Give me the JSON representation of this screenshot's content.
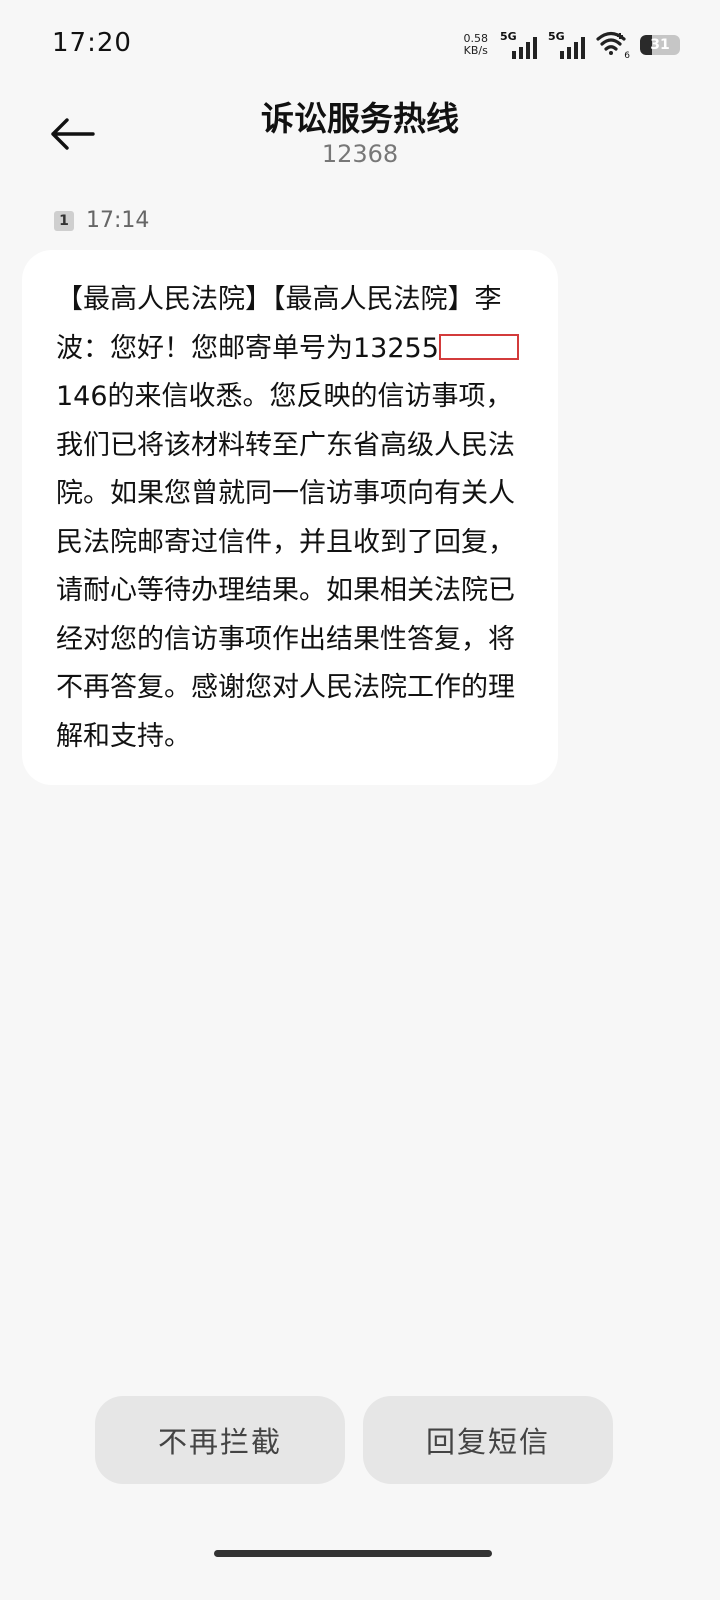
{
  "status_bar": {
    "time": "17:20",
    "net_speed_value": "0.58",
    "net_speed_unit": "KB/s",
    "sim1_gen": "5G",
    "sim2_gen": "5G",
    "wifi_num": "6",
    "battery_level": "31",
    "battery_fraction": 0.31
  },
  "header": {
    "title": "诉讼服务热线",
    "number": "12368",
    "back_icon": "arrow-left-icon"
  },
  "message": {
    "sim_slot": "1",
    "time": "17:14",
    "text_before_redaction": "【最高人民法院】【最高人民法院】李波：您好！您邮寄单号为13255",
    "text_after_redaction": "146的来信收悉。您反映的信访事项，我们已将该材料转至广东省高级人民法院。如果您曾就同一信访事项向有关人民法院邮寄过信件，并且收到了回复，请耐心等待办理结果。如果相关法院已经对您的信访事项作出结果性答复，将不再答复。感谢您对人民法院工作的理解和支持。",
    "redaction_color": "#d33b3b"
  },
  "actions": {
    "unblock_label": "不再拦截",
    "reply_label": "回复短信"
  }
}
